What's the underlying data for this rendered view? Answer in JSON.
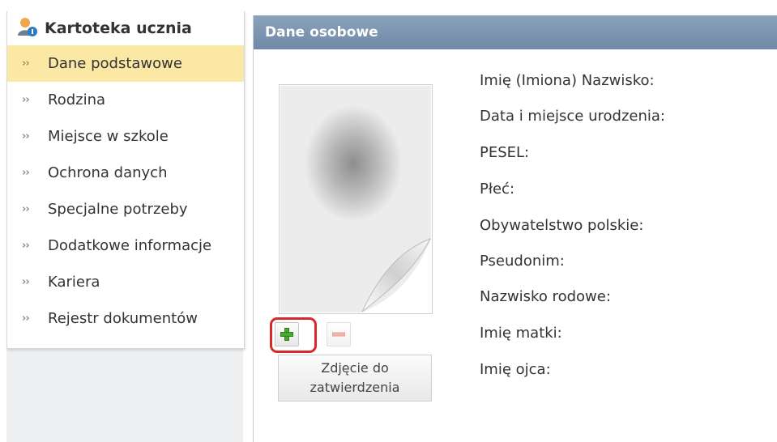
{
  "sidebar": {
    "title": "Kartoteka ucznia",
    "items": [
      {
        "label": "Dane podstawowe",
        "active": true
      },
      {
        "label": "Rodzina"
      },
      {
        "label": "Miejsce w szkole"
      },
      {
        "label": "Ochrona danych"
      },
      {
        "label": "Specjalne potrzeby"
      },
      {
        "label": "Dodatkowe informacje"
      },
      {
        "label": "Kariera"
      },
      {
        "label": "Rejestr dokumentów"
      }
    ]
  },
  "panel": {
    "title": "Dane osobowe",
    "photo_status": "Zdjęcie do zatwierdzenia",
    "fields": [
      "Imię (Imiona) Nazwisko:",
      "Data i miejsce urodzenia:",
      "PESEL:",
      "Płeć:",
      "Obywatelstwo polskie:",
      "Pseudonim:",
      "Nazwisko rodowe:",
      "Imię matki:",
      "Imię ojca:"
    ]
  },
  "colors": {
    "active_item_bg": "#fbe8a4",
    "panel_header_bg": "#7b93ae",
    "highlight": "#d8282c",
    "add_icon": "#4aa832",
    "remove_icon": "#f0b8a8"
  }
}
